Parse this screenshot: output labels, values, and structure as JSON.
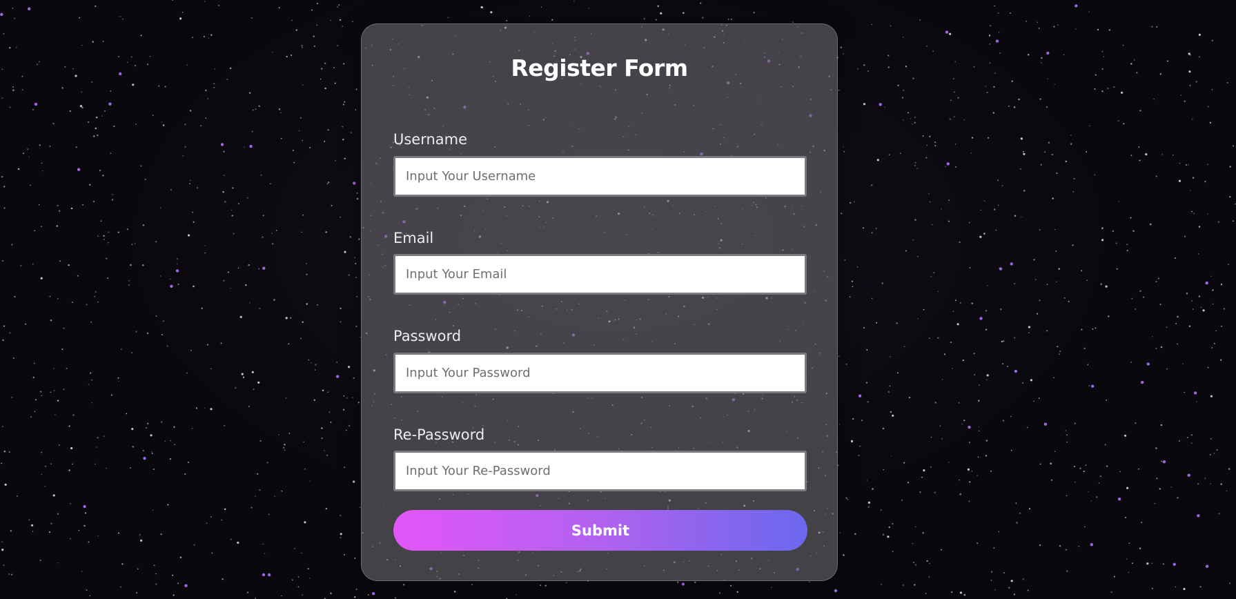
{
  "form": {
    "title": "Register Form",
    "fields": [
      {
        "label": "Username",
        "placeholder": "Input Your Username",
        "value": ""
      },
      {
        "label": "Email",
        "placeholder": "Input Your Email",
        "value": ""
      },
      {
        "label": "Password",
        "placeholder": "Input Your Password",
        "value": ""
      },
      {
        "label": "Re-Password",
        "placeholder": "Input Your Re-Password",
        "value": ""
      }
    ],
    "submit_label": "Submit"
  },
  "colors": {
    "background": "#09080c",
    "card": "#6e6c72",
    "submit_gradient_start": "#e356f7",
    "submit_gradient_end": "#6a68ee",
    "star_accent": "#a56cf5"
  }
}
